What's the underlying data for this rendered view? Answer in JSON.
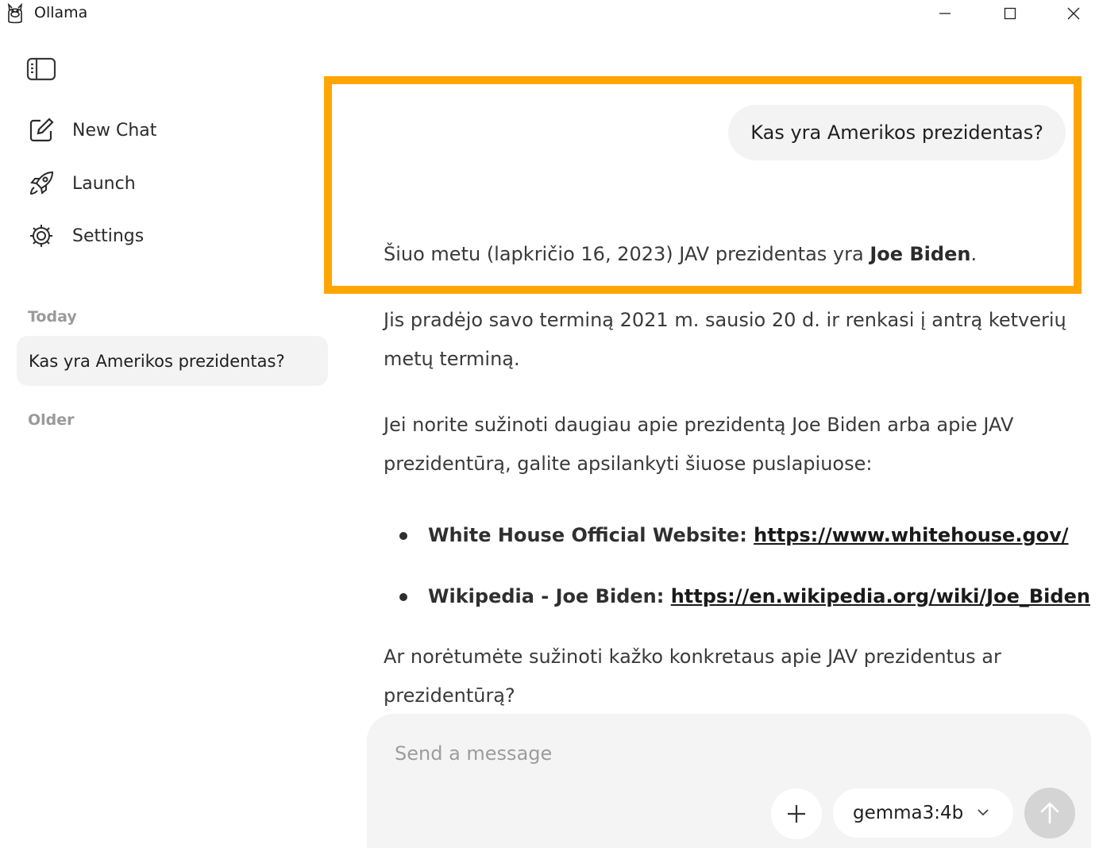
{
  "window": {
    "title": "Ollama"
  },
  "sidebar": {
    "nav": [
      {
        "label": "New Chat",
        "icon": "new-chat-icon"
      },
      {
        "label": "Launch",
        "icon": "rocket-icon"
      },
      {
        "label": "Settings",
        "icon": "gear-icon"
      }
    ],
    "sections": {
      "today": "Today",
      "older": "Older"
    },
    "chats_today": [
      {
        "title": "Kas yra Amerikos prezidentas?"
      }
    ]
  },
  "conversation": {
    "user_message": "Kas yra Amerikos prezidentas?",
    "assistant": {
      "p1_text": "Šiuo metu (lapkričio 16, 2023) JAV prezidentas yra ",
      "p1_bold": "Joe Biden",
      "p1_end": ".",
      "p2": "Jis pradėjo savo terminą 2021 m. sausio 20 d. ir renkasi į antrą ketverių metų terminą.",
      "p3": "Jei norite sužinoti daugiau apie prezidentą Joe Biden arba apie JAV prezidentūrą, galite apsilankyti šiuose puslapiuose:",
      "links": [
        {
          "label": "White House Official Website: ",
          "url": "https://www.whitehouse.gov/"
        },
        {
          "label": "Wikipedia - Joe Biden: ",
          "url": "https://en.wikipedia.org/wiki/Joe_Biden"
        }
      ],
      "p4": "Ar norėtumėte sužinoti kažko konkretaus apie JAV prezidentus ar prezidentūrą?"
    }
  },
  "composer": {
    "placeholder": "Send a message",
    "model": "gemma3:4b"
  },
  "colors": {
    "highlight": "#ffa500",
    "bubble": "#f3f3f3",
    "composer_bg": "#f4f4f4",
    "send_disabled": "#d4d4d4"
  }
}
